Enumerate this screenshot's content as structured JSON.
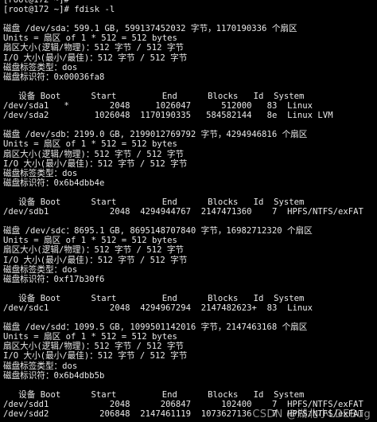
{
  "terminal": {
    "lines": [
      "[root@172 ~]#",
      "[root@172 ~]# fdisk -l",
      "",
      "磁盘 /dev/sda：599.1 GB, 599137452032 字节，1170190336 个扇区",
      "Units = 扇区 of 1 * 512 = 512 bytes",
      "扇区大小(逻辑/物理)：512 字节 / 512 字节",
      "I/O 大小(最小/最佳)：512 字节 / 512 字节",
      "磁盘标签类型：dos",
      "磁盘标识符：0x00036fa8",
      "",
      "   设备 Boot      Start         End      Blocks   Id  System",
      "/dev/sda1   *        2048     1026047      512000   83  Linux",
      "/dev/sda2         1026048  1170190335   584582144   8e  Linux LVM",
      "",
      "磁盘 /dev/sdb：2199.0 GB, 2199012769792 字节，4294946816 个扇区",
      "Units = 扇区 of 1 * 512 = 512 bytes",
      "扇区大小(逻辑/物理)：512 字节 / 512 字节",
      "I/O 大小(最小/最佳)：512 字节 / 512 字节",
      "磁盘标签类型：dos",
      "磁盘标识符：0x6b4dbb4e",
      "",
      "   设备 Boot      Start         End      Blocks   Id  System",
      "/dev/sdb1            2048  4294944767  2147471360    7  HPFS/NTFS/exFAT",
      "",
      "磁盘 /dev/sdc：8695.1 GB, 8695148707840 字节，16982712320 个扇区",
      "Units = 扇区 of 1 * 512 = 512 bytes",
      "扇区大小(逻辑/物理)：512 字节 / 512 字节",
      "I/O 大小(最小/最佳)：512 字节 / 512 字节",
      "磁盘标签类型：dos",
      "磁盘标识符：0xf17b30f6",
      "",
      "   设备 Boot      Start         End      Blocks   Id  System",
      "/dev/sdc1            2048  4294967294  2147482623+  83  Linux",
      "",
      "磁盘 /dev/sdd：1099.5 GB, 1099501142016 字节，2147463168 个扇区",
      "Units = 扇区 of 1 * 512 = 512 bytes",
      "扇区大小(逻辑/物理)：512 字节 / 512 字节",
      "I/O 大小(最小/最佳)：512 字节 / 512 字节",
      "磁盘标签类型：dos",
      "磁盘标识符：0x6b4dbb5b",
      "",
      "   设备 Boot      Start         End      Blocks   Id  System",
      "/dev/sdd1            2048      206847      102400    7  HPFS/NTFS/exFAT",
      "/dev/sdd2          206848  2147461119  1073627136    7  HPFS/NTFS/exFAT"
    ],
    "watermark": "CSDN @湖北小LDEBug"
  },
  "colors": {
    "background": "#000000",
    "foreground": "#e8e8e8"
  }
}
